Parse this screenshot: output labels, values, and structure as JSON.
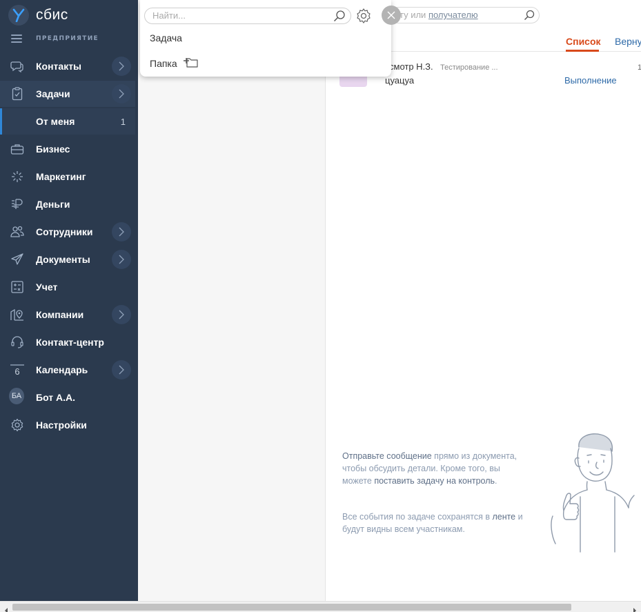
{
  "app": {
    "logo_text": "сбис",
    "org_label": "ПРЕДПРИЯТИЕ"
  },
  "nav": {
    "items": [
      {
        "label": "Контакты",
        "icon": "chat-icon",
        "has_chevron": true
      },
      {
        "label": "Задачи",
        "icon": "tasks-icon",
        "has_chevron": true,
        "active": true
      },
      {
        "label": "От меня",
        "sub": true,
        "count": "1"
      },
      {
        "label": "Бизнес",
        "icon": "briefcase-icon"
      },
      {
        "label": "Маркетинг",
        "icon": "marketing-icon"
      },
      {
        "label": "Деньги",
        "icon": "money-icon"
      },
      {
        "label": "Сотрудники",
        "icon": "people-icon",
        "has_chevron": true
      },
      {
        "label": "Документы",
        "icon": "paper-plane-icon",
        "has_chevron": true
      },
      {
        "label": "Учет",
        "icon": "calculator-icon"
      },
      {
        "label": "Компании",
        "icon": "companies-icon",
        "has_chevron": true
      },
      {
        "label": "Контакт-центр",
        "icon": "headset-icon"
      },
      {
        "label": "Календарь",
        "icon": "calendar-icon",
        "calendar_day": "6",
        "has_chevron": true
      },
      {
        "label": "Бот А.А.",
        "avatar_initials": "БА"
      },
      {
        "label": "Настройки",
        "icon": "gear-icon"
      }
    ]
  },
  "popup": {
    "search_placeholder": "Найти...",
    "item_task": "Задача",
    "item_folder": "Папка"
  },
  "right": {
    "search_prefix": "ту или ",
    "search_link": "получателю",
    "tab_list": "Список",
    "tab_return": "Верну",
    "row": {
      "author": "смотр Н.З.",
      "tag": "Тестирование ...",
      "text": "цуацуа",
      "status": "Выполнение",
      "number": "1"
    },
    "hint1": {
      "strong1": "Отправьте сообщение",
      "text1": " прямо из документа, чтобы обсудить детали. Кроме того, вы можете ",
      "strong2": "поставить задачу на контроль",
      "text2": "."
    },
    "hint2": {
      "text1": "Все события по задаче сохранятся в ",
      "strong1": "ленте",
      "text2": " и будут видны всем участникам."
    }
  },
  "colors": {
    "sidebar": "#2b3a4e",
    "accent": "#d84a1b",
    "link": "#2e6aa8"
  }
}
